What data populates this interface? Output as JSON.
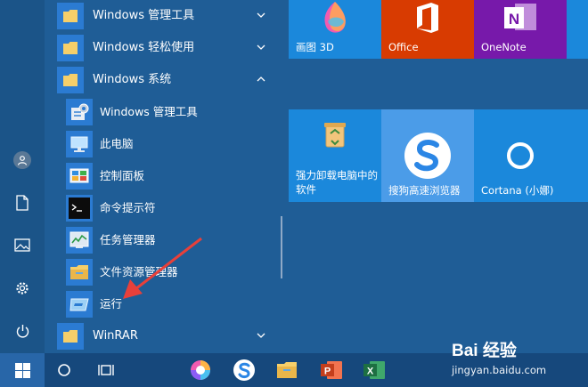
{
  "app_list": {
    "groups": [
      {
        "label": "Windows 管理工具",
        "expanded": false
      },
      {
        "label": "Windows 轻松使用",
        "expanded": false
      },
      {
        "label": "Windows 系统",
        "expanded": true
      }
    ],
    "items": [
      {
        "label": "Windows 管理工具",
        "icon": "admin-tools-icon"
      },
      {
        "label": "此电脑",
        "icon": "this-pc-icon"
      },
      {
        "label": "控制面板",
        "icon": "control-panel-icon"
      },
      {
        "label": "命令提示符",
        "icon": "cmd-icon"
      },
      {
        "label": "任务管理器",
        "icon": "task-manager-icon"
      },
      {
        "label": "文件资源管理器",
        "icon": "file-explorer-icon"
      },
      {
        "label": "运行",
        "icon": "run-icon"
      }
    ],
    "bottom_group": {
      "label": "WinRAR",
      "expanded": false
    }
  },
  "tiles": {
    "row1": [
      {
        "label": "画图 3D",
        "color": "#1b88db",
        "icon": "paint3d-icon"
      },
      {
        "label": "Office",
        "color": "#d83b01",
        "icon": "office-icon"
      },
      {
        "label": "OneNote",
        "color": "#7719aa",
        "icon": "onenote-icon"
      }
    ],
    "row2": [
      {
        "label": "强力卸载电脑中的软件",
        "color": "#1b88db",
        "icon": "recycle-bin-icon"
      },
      {
        "label": "搜狗高速浏览器",
        "color": "#4b9ce8",
        "icon": "sogou-browser-icon"
      },
      {
        "label": "Cortana (小娜)",
        "color": "#1b88db",
        "icon": "cortana-icon"
      }
    ]
  },
  "watermark": {
    "main": "Bai 经验",
    "sub": "jingyan.baidu.com"
  },
  "colors": {
    "start_bg": "#1f5d96",
    "taskbar": "#16487c",
    "tile_blue": "#1b88db",
    "folder_tile": "#2b7bd2",
    "arrow": "#e8403a"
  }
}
